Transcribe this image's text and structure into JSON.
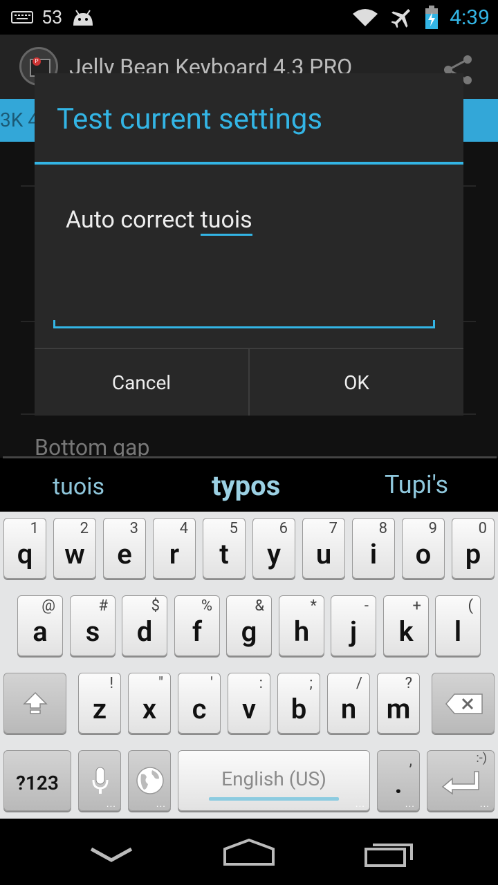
{
  "status_bar": {
    "notification_count": "53",
    "time": "4:39",
    "icons": [
      "keyboard-icon",
      "android-icon",
      "wifi-icon",
      "airplane-mode-icon",
      "battery-charging-icon"
    ]
  },
  "app": {
    "title": "Jelly Bean Keyboard 4.3 PRO",
    "band_text": "3K 4",
    "bottom_gap_label": "Bottom gap"
  },
  "dialog": {
    "title": "Test current settings",
    "input_prefix": "Auto correct ",
    "input_word": "tuois",
    "cancel_label": "Cancel",
    "ok_label": "OK"
  },
  "suggestions": [
    "tuois",
    "typos",
    "Tupi's"
  ],
  "suggestion_more": "...",
  "keyboard": {
    "row1": [
      {
        "key": "q",
        "hint": "1"
      },
      {
        "key": "w",
        "hint": "2"
      },
      {
        "key": "e",
        "hint": "3"
      },
      {
        "key": "r",
        "hint": "4"
      },
      {
        "key": "t",
        "hint": "5"
      },
      {
        "key": "y",
        "hint": "6"
      },
      {
        "key": "u",
        "hint": "7"
      },
      {
        "key": "i",
        "hint": "8"
      },
      {
        "key": "o",
        "hint": "9"
      },
      {
        "key": "p",
        "hint": "0"
      }
    ],
    "row2": [
      {
        "key": "a",
        "hint": "@"
      },
      {
        "key": "s",
        "hint": "#"
      },
      {
        "key": "d",
        "hint": "$"
      },
      {
        "key": "f",
        "hint": "%"
      },
      {
        "key": "g",
        "hint": "&"
      },
      {
        "key": "h",
        "hint": "*"
      },
      {
        "key": "j",
        "hint": "-"
      },
      {
        "key": "k",
        "hint": "+"
      },
      {
        "key": "l",
        "hint": "("
      }
    ],
    "row3": [
      {
        "key": "z",
        "hint": "!"
      },
      {
        "key": "x",
        "hint": "\""
      },
      {
        "key": "c",
        "hint": "'"
      },
      {
        "key": "v",
        "hint": ":"
      },
      {
        "key": "b",
        "hint": ";"
      },
      {
        "key": "n",
        "hint": "/"
      },
      {
        "key": "m",
        "hint": "?"
      }
    ],
    "symbols_label": "?123",
    "space_label": "English (US)",
    "period_label": ".",
    "period_hint": ",",
    "enter_hint": ":-)",
    "more_dots": "..."
  },
  "nav_bar": {
    "icons": [
      "back-icon",
      "home-icon",
      "recents-icon"
    ]
  }
}
